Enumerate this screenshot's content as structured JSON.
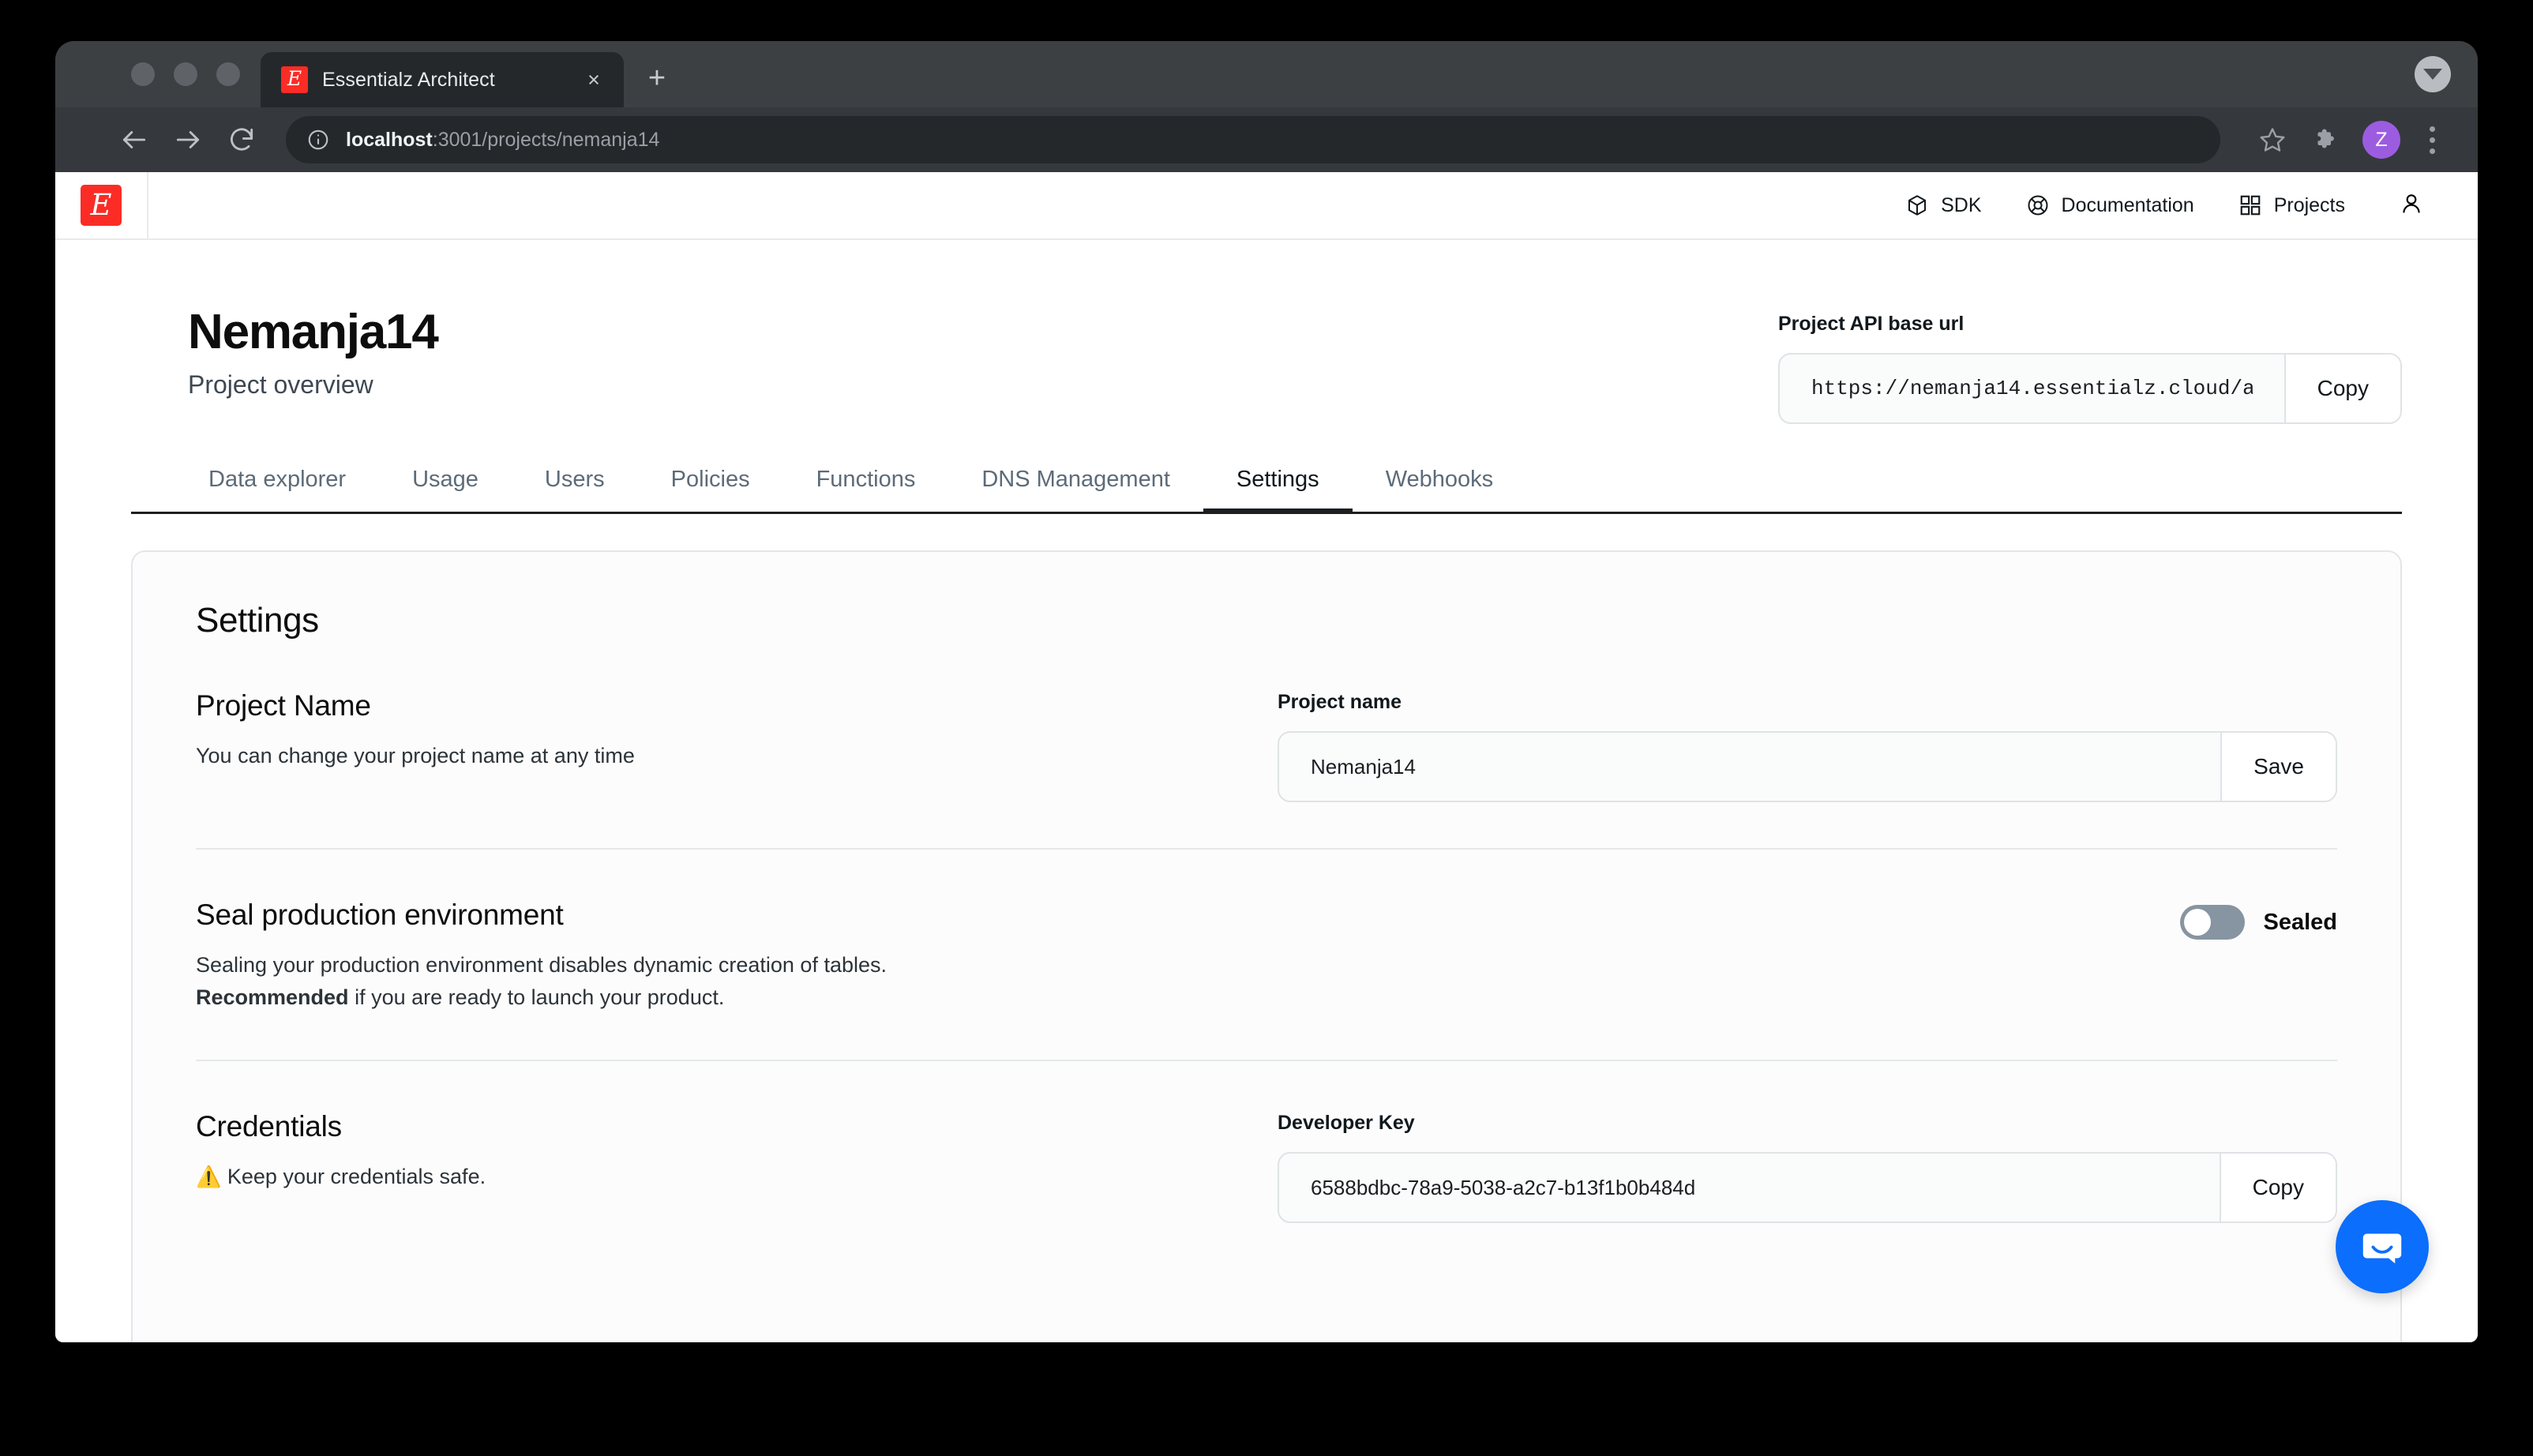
{
  "browser": {
    "tab_title": "Essentialz Architect",
    "tab_favicon_glyph": "E",
    "close_label": "×",
    "new_tab_label": "+",
    "url_bold": "localhost",
    "url_rest": ":3001/projects/nemanja14",
    "profile_initial": "Z"
  },
  "app_header": {
    "logo_glyph": "E",
    "nav": [
      {
        "label": "SDK",
        "icon": "cube-icon"
      },
      {
        "label": "Documentation",
        "icon": "lifebuoy-icon"
      },
      {
        "label": "Projects",
        "icon": "grid-icon"
      }
    ],
    "account_icon": "user-icon"
  },
  "page": {
    "title": "Nemanja14",
    "subtitle": "Project overview",
    "api": {
      "label": "Project API base url",
      "value": "https://nemanja14.essentialz.cloud/a",
      "copy_label": "Copy"
    },
    "tabs": [
      {
        "label": "Data explorer",
        "active": false
      },
      {
        "label": "Usage",
        "active": false
      },
      {
        "label": "Users",
        "active": false
      },
      {
        "label": "Policies",
        "active": false
      },
      {
        "label": "Functions",
        "active": false
      },
      {
        "label": "DNS Management",
        "active": false
      },
      {
        "label": "Settings",
        "active": true
      },
      {
        "label": "Webhooks",
        "active": false
      }
    ]
  },
  "settings": {
    "card_title": "Settings",
    "project_name": {
      "heading": "Project Name",
      "description": "You can change your project name at any time",
      "field_label": "Project name",
      "value": "Nemanja14",
      "button": "Save"
    },
    "seal": {
      "heading": "Seal production environment",
      "line1": "Sealing your production environment disables dynamic creation of tables.",
      "line2_bold": "Recommended",
      "line2_rest": " if you are ready to launch your product.",
      "toggle_label": "Sealed",
      "toggle_on": false
    },
    "credentials": {
      "heading": "Credentials",
      "warning_icon": "⚠️",
      "warning_text": "Keep your credentials safe.",
      "field_label": "Developer Key",
      "value": "6588bdbc-78a9-5038-a2c7-b13f1b0b484d",
      "button": "Copy"
    }
  },
  "widgets": {
    "intercom_label": "Open Intercom Messenger"
  },
  "colors": {
    "brand_red": "#fb2c26",
    "intercom_blue": "#0b6efd",
    "profile_purple": "#9c5ce0",
    "toggle_track": "#8794a1"
  }
}
